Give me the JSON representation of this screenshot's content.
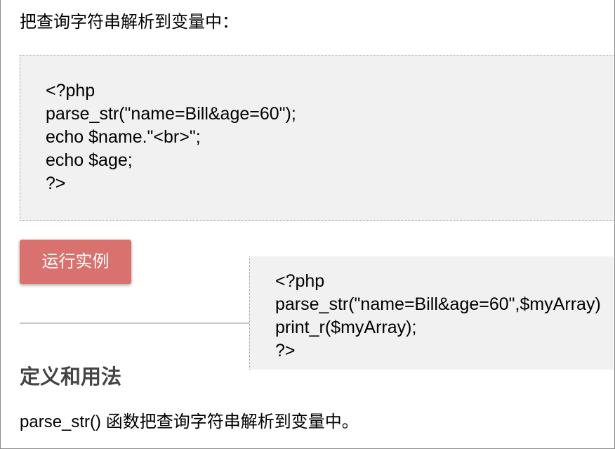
{
  "intro_text": "把查询字符串解析到变量中：",
  "example_code": {
    "lines": [
      "<?php",
      "parse_str(\"name=Bill&age=60\");",
      "echo $name.\"<br>\";",
      "echo $age;",
      "?>"
    ]
  },
  "run_button": {
    "label": "运行实例"
  },
  "overlay_code": {
    "lines": [
      "<?php",
      "parse_str(\"name=Bill&age=60\",$myArray)",
      "print_r($myArray);",
      "?>"
    ]
  },
  "section": {
    "heading": "定义和用法",
    "description": "parse_str() 函数把查询字符串解析到变量中。"
  },
  "colors": {
    "button": "#d9726f",
    "button_text": "#ffffff",
    "code_background": "#f1f1f1",
    "code_border": "#999999",
    "heading": "#444444",
    "text": "#000000",
    "divider": "#c6c6c6"
  }
}
